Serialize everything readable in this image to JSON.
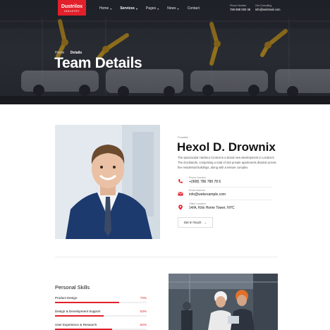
{
  "header": {
    "logo": {
      "brand": "Dustrilox",
      "sub": "INDUSTRY"
    },
    "nav": [
      {
        "label": "Home",
        "has_dropdown": true,
        "active": false
      },
      {
        "label": "Services",
        "has_dropdown": true,
        "active": true
      },
      {
        "label": "Pages",
        "has_dropdown": true,
        "active": false
      },
      {
        "label": "News",
        "has_dropdown": true,
        "active": false
      },
      {
        "label": "Contact",
        "has_dropdown": false,
        "active": false
      }
    ],
    "contact": [
      {
        "label": "Phone Number",
        "value": "786 888 000 36"
      },
      {
        "label": "Get Consulting",
        "value": "info@webmail.com"
      }
    ]
  },
  "hero": {
    "breadcrumb": {
      "home": "Home",
      "separator": "-",
      "current": "Details"
    },
    "title": "Team Details"
  },
  "profile": {
    "role": "Founder",
    "name": "Hexol D. Drownix",
    "bio": "The spectacular Harbour Central is a brand new development in London's The Docklands, comprising a total of 442 private apartments divided across five residential buildings, along with a leisure complex.",
    "info": [
      {
        "icon": "phone-icon",
        "label": "Phone Number",
        "value": "+(908) 786 789 78 6"
      },
      {
        "icon": "mail-icon",
        "label": "Email Address",
        "value": "info@webexample.com"
      },
      {
        "icon": "location-pin-icon",
        "label": "Office Location",
        "value": "14/A, Kilix Home Tower, NYC"
      }
    ],
    "button_label": "Get In Touch",
    "button_arrow": "→"
  },
  "skills": {
    "title": "Personal Skills",
    "items": [
      {
        "label": "Product Design",
        "value": "70%",
        "fraction": 0.7
      },
      {
        "label": "Design & Development Support",
        "value": "53%",
        "fraction": 0.53
      },
      {
        "label": "User Experience & Research",
        "value": "62%",
        "fraction": 0.62
      }
    ]
  },
  "colors": {
    "accent": "#e3202a",
    "dark": "#111111",
    "hero_bg": "#2c3037"
  }
}
